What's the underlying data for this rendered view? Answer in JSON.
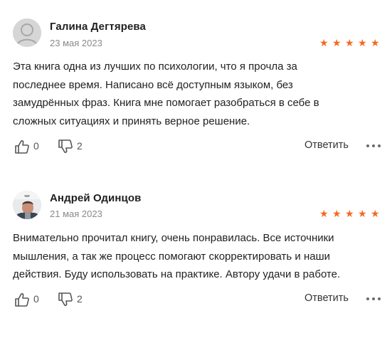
{
  "reviews": [
    {
      "author": "Галина Дегтярева",
      "date": "23 мая 2023",
      "rating": 5,
      "star_glyph": "★",
      "text_lines": [
        "Эта книга одна из лучших по психологии, что я прочла за",
        "последнее время. Написано всё доступным языком, без",
        "замудрённых фраз. Книга мне помогает разобраться в себе в",
        "сложных ситуациях и принять верное решение."
      ],
      "likes": "0",
      "dislikes": "2",
      "reply_label": "Ответить",
      "avatar": "default-user-avatar"
    },
    {
      "author": "Андрей Одинцов",
      "date": "21 мая 2023",
      "rating": 5,
      "star_glyph": "★",
      "text_lines": [
        "Внимательно прочитал книгу, очень понравилась. Все источники",
        "мышления, а так же процесс помогают скорректировать и наши",
        "действия. Буду использовать на практике. Автору удачи в работе."
      ],
      "likes": "0",
      "dislikes": "2",
      "reply_label": "Ответить",
      "avatar": "user-photo-avatar"
    }
  ],
  "colors": {
    "star": "#f26a21",
    "date": "#8a8a8a",
    "text": "#222222",
    "icon": "#555555"
  },
  "icons": [
    "thumbs-up-icon",
    "thumbs-down-icon",
    "more-dots-icon",
    "star-icon"
  ]
}
